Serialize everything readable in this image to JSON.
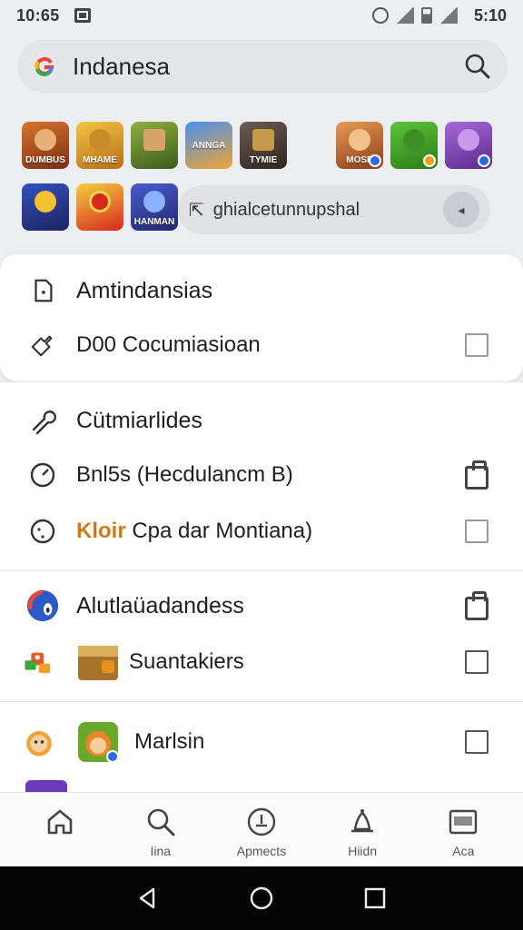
{
  "status_bar": {
    "time": "10:65",
    "battery_text": "5:10"
  },
  "search": {
    "query": "Indanesa",
    "logo_icon": "google-g-icon",
    "search_icon": "search-icon"
  },
  "apps": {
    "row1": [
      {
        "name": "app-tile-1",
        "label": "DUMBUS",
        "bg": "#c4561f"
      },
      {
        "name": "app-tile-2",
        "label": "MHAME",
        "bg": "#e2a524"
      },
      {
        "name": "app-tile-3",
        "label": "",
        "bg": "#6b8e2f"
      },
      {
        "name": "app-tile-4",
        "label": "ANNGA",
        "bg": "#2d6ed3"
      },
      {
        "name": "app-tile-5",
        "label": "TYMIE",
        "bg": "#5a4a40"
      },
      {
        "name": "app-tile-6",
        "label": "MOSE",
        "bg": "#c46a2f"
      },
      {
        "name": "app-tile-7",
        "label": "",
        "bg": "#49a82a"
      },
      {
        "name": "app-tile-8",
        "label": "",
        "bg": "#8d4fc2"
      }
    ],
    "row2": [
      {
        "name": "app-tile-9",
        "label": "",
        "bg": "#2c3f9a"
      },
      {
        "name": "app-tile-10",
        "label": "",
        "bg": "#d8271c"
      },
      {
        "name": "app-tile-11",
        "label": "HANMAN",
        "bg": "#3b3b8c"
      }
    ],
    "chip_text": "ghialcetunnupshal",
    "chip_button_icon": "arrow-left-icon"
  },
  "list": {
    "section1": {
      "heading": "Amtindansias",
      "items": [
        {
          "label": "D00 Cocumiasioan"
        }
      ]
    },
    "section2": {
      "heading": "Cütmiarlides",
      "items": [
        {
          "label": "Bnl5s (Hecdulancm B)"
        },
        {
          "prefix": "Kloir",
          "label": "Cpa dar Montiana)"
        }
      ]
    },
    "section3": {
      "heading": "Alutlaüadandess",
      "items": [
        {
          "label": "Suantakiers"
        }
      ]
    },
    "section4": {
      "items": [
        {
          "label": "Marlsin"
        }
      ]
    }
  },
  "bottom_nav": {
    "items": [
      {
        "label": "",
        "icon": "home-icon"
      },
      {
        "label": "Iina",
        "icon": "search-icon"
      },
      {
        "label": "Apmects",
        "icon": "history-icon"
      },
      {
        "label": "Hiidn",
        "icon": "bell-icon"
      },
      {
        "label": "Aca",
        "icon": "library-icon"
      }
    ]
  },
  "colors": {
    "accent": "#2c6ae0",
    "highlight": "#d27a12",
    "background": "#eceef2"
  }
}
